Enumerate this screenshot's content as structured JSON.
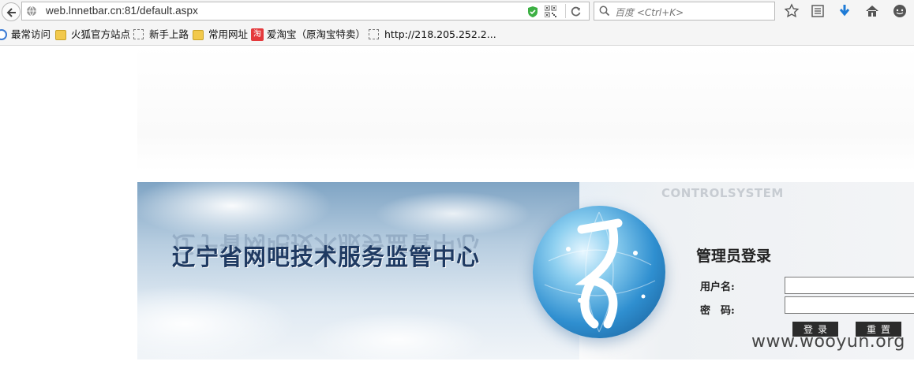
{
  "browser": {
    "url": "web.lnnetbar.cn:81/default.aspx",
    "search_placeholder": "百度 <Ctrl+K>",
    "bookmarks": [
      {
        "label": "最常访问",
        "icon": "most-visited-icon"
      },
      {
        "label": "火狐官方站点",
        "icon": "folder-icon"
      },
      {
        "label": "新手上路",
        "icon": "page-icon"
      },
      {
        "label": "常用网址",
        "icon": "folder-icon"
      },
      {
        "label": "爱淘宝（原淘宝特卖）",
        "icon": "taobao-icon",
        "icon_text": "淘"
      },
      {
        "label": "http://218.205.252.2...",
        "icon": "page-icon"
      }
    ]
  },
  "page": {
    "brand": "CONTROLSYSTEM",
    "title": "辽宁省网吧技术服务监管中心",
    "login": {
      "heading": "管理员登录",
      "username_label": "用户名:",
      "password_label": "密　码:",
      "username_value": "",
      "password_value": "",
      "login_button": "登录",
      "reset_button": "重置"
    },
    "watermark": "www.wooyun.org"
  },
  "colors": {
    "title": "#1f3a62",
    "button_bg": "#2b2b2b",
    "download_arrow": "#1e7bd6"
  }
}
